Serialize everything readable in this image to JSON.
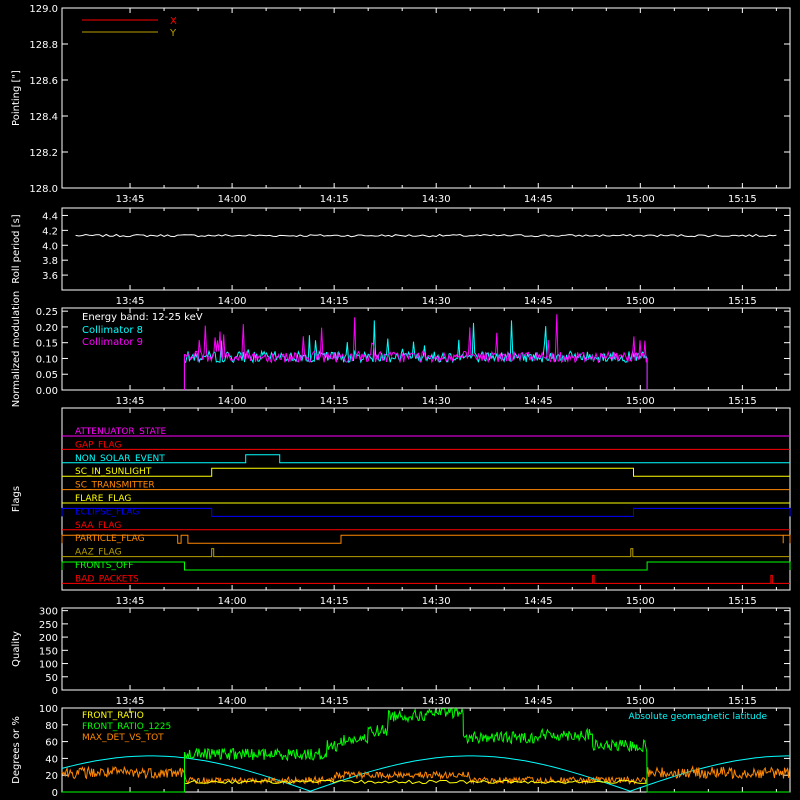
{
  "time_axis": {
    "tick_labels": [
      "13:45",
      "14:00",
      "14:15",
      "14:30",
      "14:45",
      "15:00",
      "15:15"
    ],
    "tick_minutes": [
      45,
      60,
      75,
      90,
      105,
      120,
      135
    ],
    "range_minutes": [
      35,
      142
    ]
  },
  "colors": {
    "background": "#000000",
    "axes": "#ffffff",
    "red": "#ff0000",
    "olive": "#b8a000",
    "cyan": "#00ffff",
    "magenta": "#ff00ff",
    "green": "#00ff00",
    "orange": "#ff8800",
    "yellow": "#ffff00",
    "blue": "#0000ff"
  },
  "chart_data": [
    {
      "type": "line",
      "panel": "pointing",
      "ylabel": "Pointing [\"]",
      "ylim": [
        128.0,
        129.0
      ],
      "y_ticks": [
        "128.0",
        "128.2",
        "128.4",
        "128.6",
        "128.8",
        "129.0"
      ],
      "series": [
        {
          "name": "X",
          "color": "#ff0000",
          "values": []
        },
        {
          "name": "Y",
          "color": "#b8a000",
          "values": []
        }
      ]
    },
    {
      "type": "line",
      "panel": "roll_period",
      "ylabel": "Roll period [s]",
      "ylim": [
        3.4,
        4.5
      ],
      "y_ticks": [
        "3.6",
        "3.8",
        "4.0",
        "4.2",
        "4.4"
      ],
      "series": [
        {
          "color": "#ffffff",
          "x": [
            37,
            140
          ],
          "y": [
            4.13,
            4.13
          ]
        }
      ]
    },
    {
      "type": "line",
      "panel": "modulation",
      "ylabel": "Normalized modulation",
      "ylim": [
        0,
        0.26
      ],
      "y_ticks": [
        "0.00",
        "0.05",
        "0.10",
        "0.15",
        "0.20",
        "0.25"
      ],
      "annotation": "Energy band: 12-25 keV",
      "series": [
        {
          "name": "Collimator 8",
          "color": "#00ffff",
          "x_range": [
            53,
            121
          ],
          "base": 0.1,
          "peak": 0.23
        },
        {
          "name": "Collimator 9",
          "color": "#ff00ff",
          "x_range": [
            53,
            121
          ],
          "base": 0.1,
          "peak": 0.24
        }
      ]
    },
    {
      "type": "line",
      "panel": "flags",
      "ylabel": "Flags",
      "flags": [
        {
          "name": "ATTENUATOR_STATE",
          "color": "#ff00ff",
          "high": []
        },
        {
          "name": "GAP_FLAG",
          "color": "#ff0000",
          "high": []
        },
        {
          "name": "NON_SOLAR_EVENT",
          "color": "#00ffff",
          "high": [
            [
              62,
              67
            ]
          ]
        },
        {
          "name": "SC_IN_SUNLIGHT",
          "color": "#ffff00",
          "high": [
            [
              57,
              119
            ]
          ]
        },
        {
          "name": "SC_TRANSMITTER",
          "color": "#ff8800",
          "high": []
        },
        {
          "name": "FLARE_FLAG",
          "color": "#ffff00",
          "high": []
        },
        {
          "name": "ECLIPSE_FLAG",
          "color": "#0000ff",
          "high": [
            [
              35,
              57
            ],
            [
              119,
              142
            ]
          ]
        },
        {
          "name": "SAA_FLAG",
          "color": "#ff0000",
          "high": []
        },
        {
          "name": "PARTICLE_FLAG",
          "color": "#ff8800",
          "high": [
            [
              35,
              52
            ],
            [
              52.5,
              53.5
            ],
            [
              76,
              141
            ],
            [
              141,
              142
            ]
          ]
        },
        {
          "name": "AAZ_FLAG",
          "color": "#b8a000",
          "high": [
            [
              57,
              57.3
            ],
            [
              118.6,
              118.9
            ]
          ]
        },
        {
          "name": "FRONTS_OFF",
          "color": "#00ff00",
          "high": [
            [
              35,
              53
            ],
            [
              121,
              142
            ]
          ]
        },
        {
          "name": "BAD_PACKETS",
          "color": "#ff0000",
          "high": [
            [
              113,
              113.2
            ],
            [
              139.2,
              139.4
            ]
          ]
        }
      ]
    },
    {
      "type": "line",
      "panel": "quality",
      "ylabel": "Quality",
      "ylim": [
        0,
        310
      ],
      "y_ticks": [
        "0",
        "50",
        "100",
        "150",
        "200",
        "250",
        "300"
      ],
      "series": []
    },
    {
      "type": "line",
      "panel": "ratios",
      "ylabel": "Degrees or %",
      "ylim": [
        0,
        100
      ],
      "y_ticks": [
        "0",
        "20",
        "40",
        "60",
        "80",
        "100"
      ],
      "series": [
        {
          "name": "FRONT_RATIO",
          "color": "#ffff00",
          "x_range": [
            53,
            121
          ],
          "level": 12
        },
        {
          "name": "FRONT_RATIO_1225",
          "color": "#00ff00",
          "segments": [
            [
              53,
              74,
              45
            ],
            [
              74,
              76,
              55
            ],
            [
              76,
              80,
              62
            ],
            [
              80,
              83,
              73
            ],
            [
              83,
              89,
              91
            ],
            [
              89,
              94,
              95
            ],
            [
              94,
              105,
              65
            ],
            [
              105,
              113,
              68
            ],
            [
              113,
              121,
              55
            ]
          ]
        },
        {
          "name": "MAX_DET_VS_TOT",
          "color": "#ff8800",
          "level": 23
        },
        {
          "name": "Absolute geomagnetic latitude",
          "color": "#00ffff",
          "min": 1,
          "max": 43,
          "period_minutes": 47
        }
      ]
    }
  ]
}
